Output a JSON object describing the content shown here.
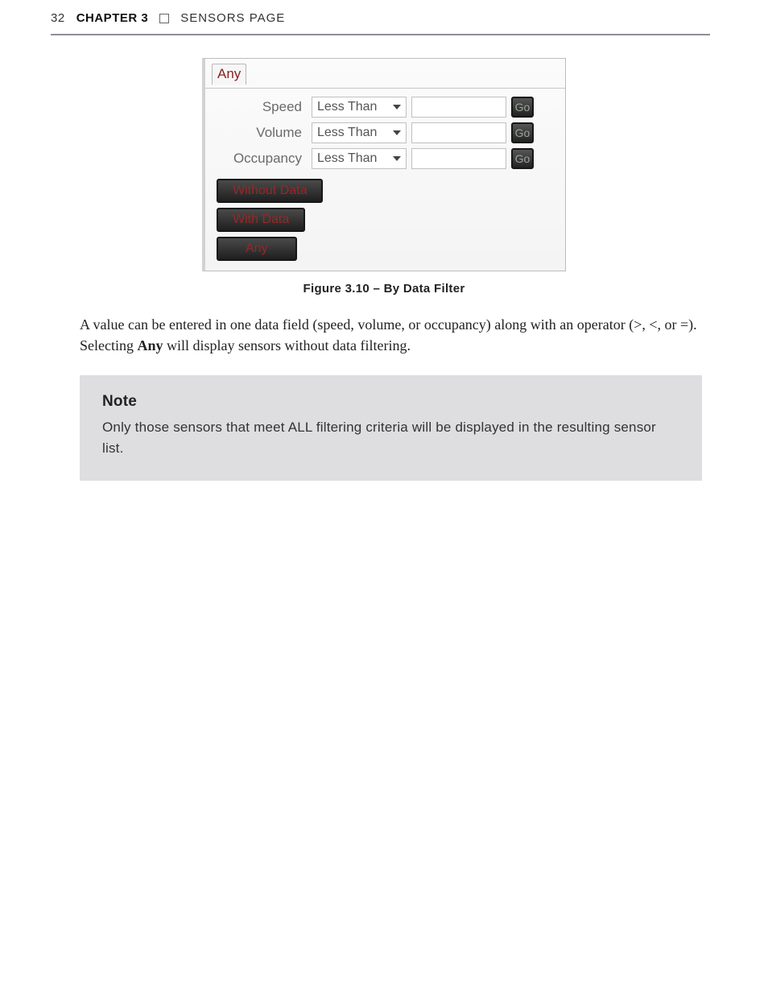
{
  "header": {
    "page_number": "32",
    "chapter": "CHAPTER 3",
    "section_title": "SENSORS PAGE"
  },
  "screenshot": {
    "tab_label": "Any",
    "rows": [
      {
        "label": "Speed",
        "operator": "Less Than",
        "go": "Go"
      },
      {
        "label": "Volume",
        "operator": "Less Than",
        "go": "Go"
      },
      {
        "label": "Occupancy",
        "operator": "Less Than",
        "go": "Go"
      }
    ],
    "buttons": {
      "without_data": "Without Data",
      "with_data": "With Data",
      "any": "Any"
    }
  },
  "figure_caption": "Figure 3.10 – By Data Filter",
  "paragraph": {
    "pre": "A value can be entered in one data field (speed, volume, or occupancy) along with an operator (>, <, or =). Selecting ",
    "bold": "Any",
    "post": " will display sensors without data filtering."
  },
  "note": {
    "heading": "Note",
    "body": "Only those sensors that meet ALL filtering criteria will be displayed in the resulting sensor list."
  }
}
